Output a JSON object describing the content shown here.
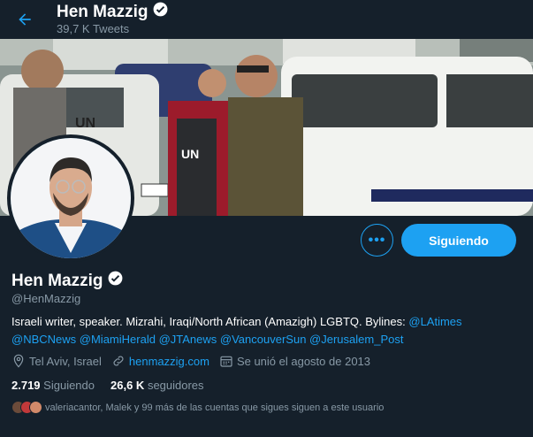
{
  "header": {
    "name": "Hen Mazzig",
    "tweet_count": "39,7 K Tweets"
  },
  "profile": {
    "display_name": "Hen Mazzig",
    "handle": "@HenMazzig",
    "bio_text": "Israeli writer, speaker. Mizrahi, Iraqi/North African (Amazigh) LGBTQ. Bylines: ",
    "bio_mentions": [
      "@LAtimes",
      "@NBCNews",
      "@MiamiHerald",
      "@JTAnews",
      "@VancouverSun",
      "@Jerusalem_Post"
    ],
    "location": "Tel Aviv, Israel",
    "website": "henmazzig.com",
    "joined": "Se unió el agosto de 2013",
    "following_count": "2.719",
    "following_label": "Siguiendo",
    "followers_count": "26,6 K",
    "followers_label": "seguidores",
    "followed_by_text": "valeriacantor, Malek y 99 más de las cuentas que sigues siguen a este usuario"
  },
  "actions": {
    "more_label": "•••",
    "follow_label": "Siguiendo"
  },
  "colors": {
    "background": "#15202b",
    "accent": "#1da1f2",
    "secondary_text": "#8899a6"
  },
  "icons": {
    "back": "arrow-left-icon",
    "verified": "verified-badge-icon",
    "location": "location-pin-icon",
    "link": "link-icon",
    "calendar": "calendar-icon"
  }
}
